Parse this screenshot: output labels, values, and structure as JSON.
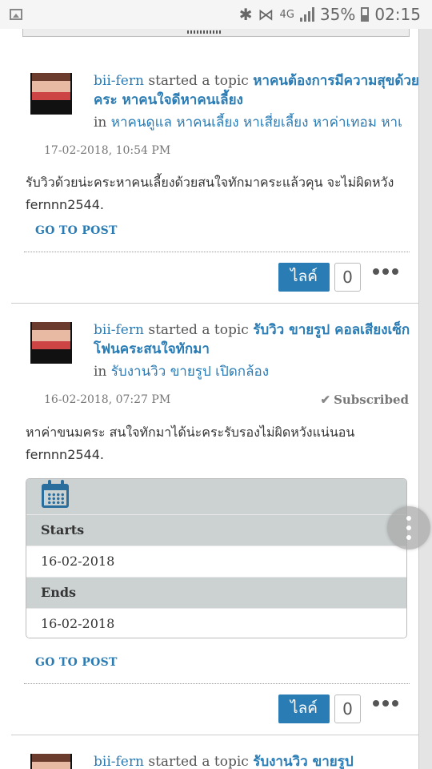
{
  "status_bar": {
    "network": "4G",
    "battery": "35%",
    "time": "02:15"
  },
  "posts": [
    {
      "author": "bii-fern",
      "action": " started a topic ",
      "topic_title": "หาคนต้องการมีความสุขด้วยคระ หาคนใจดีหาคนเลี้ยง",
      "in_label": "in ",
      "tags": [
        "หาคนดูแล",
        "หาคนเลี้ยง",
        "หาเสี่ยเลี้ยง",
        "หาค่าเทอม",
        "หาเ"
      ],
      "timestamp": "17-02-2018, 10:54 PM",
      "body": "รับวิวด้วยน่ะคระหาคนเลี้ยงด้วยสนใจทักมาคระแล้วคุน จะไม่ผิดหวัง fernnn2544.",
      "go_to_post": "GO TO POST",
      "like_label": "ไลค์",
      "like_count": "0"
    },
    {
      "author": "bii-fern",
      "action": " started a topic ",
      "topic_title": "รับวิว ขายรูป คอลเสียงเซ็กโฟนคระสนใจทักมา",
      "in_label": "in ",
      "tags": [
        "รับงานวิว",
        "ขายรูป",
        "เปิดกล้อง"
      ],
      "timestamp": "16-02-2018, 07:27 PM",
      "subscribed": "Subscribed",
      "body": "หาค่าขนมคระ สนใจทักมาได้น่ะคระรับรองไม่ผิดหวังแน่นอน fernnn2544.",
      "event": {
        "starts_label": "Starts",
        "starts_value": "16-02-2018",
        "ends_label": "Ends",
        "ends_value": "16-02-2018"
      },
      "go_to_post": "GO TO POST",
      "like_label": "ไลค์",
      "like_count": "0"
    },
    {
      "author": "bii-fern",
      "action": " started a topic ",
      "topic_title": "รับงานวิว ขายรูป"
    }
  ]
}
